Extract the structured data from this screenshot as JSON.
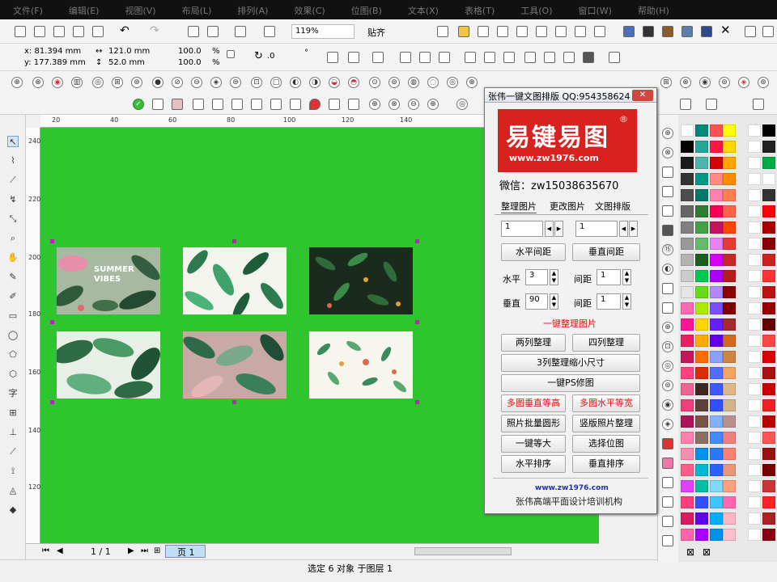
{
  "menubar": {
    "items": [
      "文件(F)",
      "编辑(E)",
      "视图(V)",
      "布局(L)",
      "排列(A)",
      "效果(C)",
      "位图(B)",
      "文本(X)",
      "表格(T)",
      "工具(O)",
      "窗口(W)",
      "帮助(H)"
    ]
  },
  "toolbar": {
    "zoom": "119%",
    "snap_label": "贴齐"
  },
  "properties": {
    "x": "x: 81.394 mm",
    "y": "y: 177.389 mm",
    "width": "121.0 mm",
    "height": "52.0 mm",
    "scale_w": "100.0",
    "scale_h": "100.0",
    "percent": "%",
    "angle": ".0",
    "degree": "°"
  },
  "ruler": {
    "h_ticks": [
      "20",
      "40",
      "60",
      "80",
      "100",
      "120",
      "140"
    ],
    "v_ticks": [
      "240",
      "220",
      "200",
      "180",
      "160",
      "140",
      "120"
    ]
  },
  "navigator": {
    "page_count": "1 / 1",
    "page_tab": "页 1"
  },
  "status": {
    "text": "选定 6 对象 于图层 1"
  },
  "panel": {
    "title": "张伟一键文图排版 QQ:954358624",
    "close": "✕",
    "logo_text": "易键易图",
    "logo_url": "www.zw1976.com",
    "logo_reg": "®",
    "wechat": "微信：zw15038635670",
    "tabs": [
      "整理图片",
      "更改图片",
      "文图排版"
    ],
    "spin_top_left": "1",
    "spin_top_right": "1",
    "btn_h_gap": "水平间距",
    "btn_v_gap": "垂直间距",
    "label_h": "水平",
    "value_h": "3",
    "label_gap1": "间距",
    "value_gap1": "1",
    "label_v": "垂直",
    "value_v": "90",
    "label_gap2": "间距",
    "value_gap2": "1",
    "section_arrange": "一键整理图片",
    "btn_two_col": "两列整理",
    "btn_four_col": "四列整理",
    "btn_three_col": "3列整理缩小尺寸",
    "btn_ps": "一键PS修图",
    "btn_multi_v": "多图垂直等高",
    "btn_multi_h": "多图水平等宽",
    "btn_batch_round": "照片批量圆形",
    "btn_portrait": "竖版照片整理",
    "btn_equal": "一键等大",
    "btn_select_bitmap": "选择位图",
    "btn_h_sort": "水平排序",
    "btn_v_sort": "垂直排序",
    "footer_url": "www.zw1976.com",
    "footer_org": "张伟高端平面设计培训机构"
  },
  "canvas": {
    "images": [
      {
        "name": "summer-vibes",
        "bg": "#a7b9a0",
        "label": "SUMMER VIBES"
      },
      {
        "name": "banana-leaves",
        "bg": "#f4f4ee",
        "label": ""
      },
      {
        "name": "dark-jungle",
        "bg": "#1a2a1c",
        "label": ""
      },
      {
        "name": "tropical-leaves",
        "bg": "#e8efe6",
        "label": ""
      },
      {
        "name": "pink-jungle",
        "bg": "#c9a9a6",
        "label": ""
      },
      {
        "name": "white-floral",
        "bg": "#f6f5ee",
        "label": ""
      }
    ]
  },
  "colors": {
    "canvas": "#2ec52e",
    "accent_red": "#d7221f",
    "selection": "#c020c0"
  }
}
